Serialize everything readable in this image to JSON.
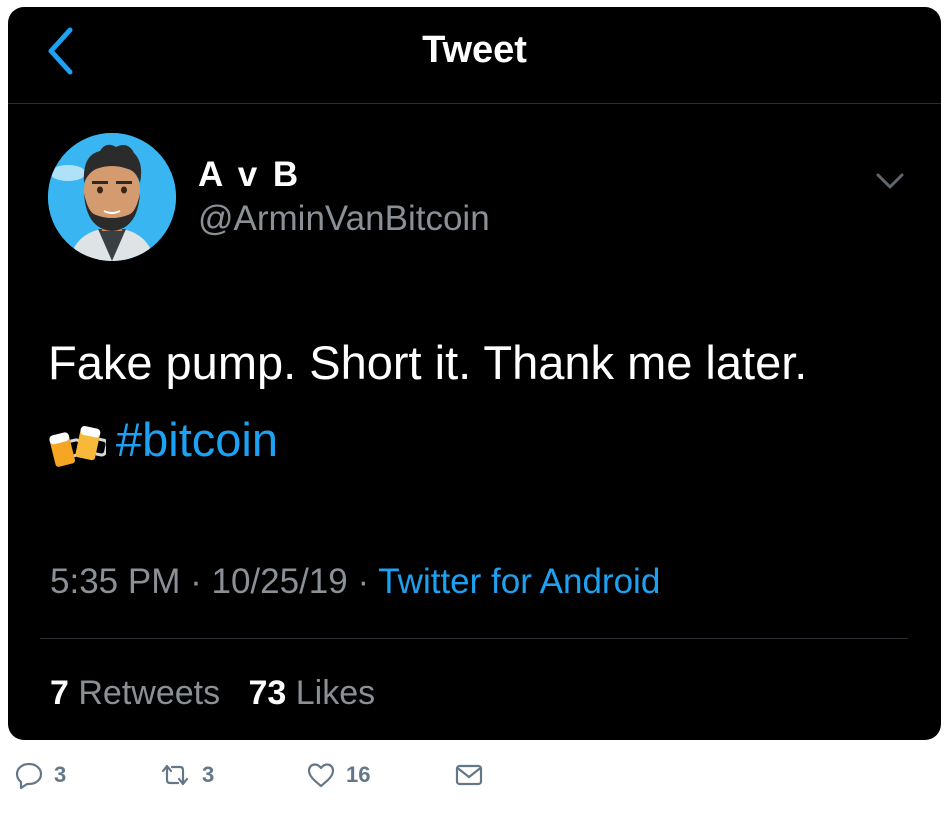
{
  "header": {
    "title": "Tweet"
  },
  "author": {
    "name": "A v B",
    "handle": "@ArminVanBitcoin"
  },
  "tweet": {
    "text": "Fake pump. Short it. Thank me later.",
    "hashtag": "#bitcoin",
    "emoji_icon": "beer-mugs-icon"
  },
  "meta": {
    "time": "5:35 PM",
    "date": "10/25/19",
    "separator": "·",
    "source": "Twitter for Android"
  },
  "stats": {
    "retweets_count": "7",
    "retweets_label": "Retweets",
    "likes_count": "73",
    "likes_label": "Likes"
  },
  "actions": {
    "replies": "3",
    "retweets": "3",
    "likes": "16"
  },
  "colors": {
    "background": "#000000",
    "text": "#ffffff",
    "muted": "#8a9096",
    "accent": "#1da1f2"
  }
}
